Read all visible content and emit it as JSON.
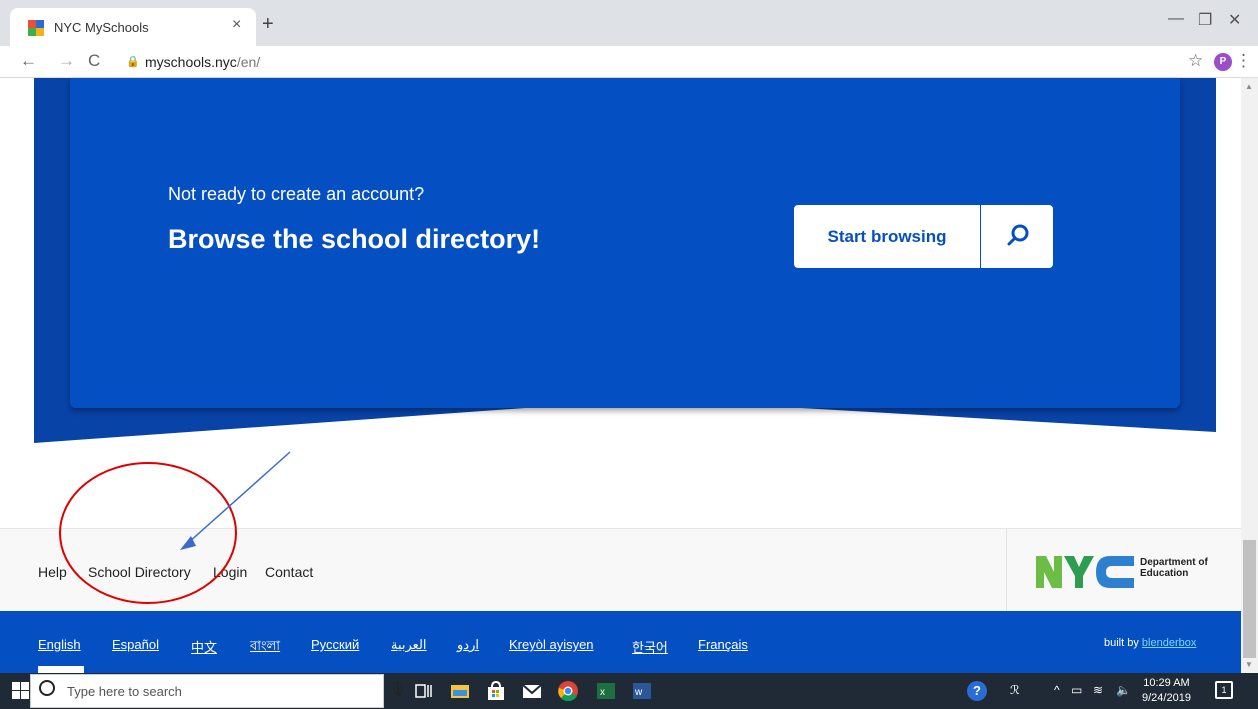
{
  "browser": {
    "tab_title": "NYC MySchools",
    "close_tab": "×",
    "new_tab": "+",
    "url_host": "myschools.nyc",
    "url_path": "/en/",
    "profile_initial": "P"
  },
  "banner": {
    "subtitle": "Not ready to create an account?",
    "title": "Browse the school directory!",
    "start_button": "Start browsing"
  },
  "footer": {
    "links": [
      "Help",
      "School Directory",
      "Login",
      "Contact"
    ],
    "dept_line1": "Department of",
    "dept_line2": "Education"
  },
  "languages": [
    "English",
    "Español",
    "中文",
    "বাংলা",
    "Русский",
    "العربية",
    "اردو",
    "Kreyòl ayisyen",
    "한국어",
    "Français"
  ],
  "built_by": {
    "prefix": "built by ",
    "link": "blenderbox"
  },
  "taskbar": {
    "search_placeholder": "Type here to search",
    "time": "10:29 AM",
    "date": "9/24/2019",
    "notification_count": "1"
  },
  "colors": {
    "brand_blue": "#0450c3",
    "annotation_red": "#e00000",
    "annotation_arrow": "#3a6cc8"
  },
  "icons": [
    "search-icon",
    "back-icon",
    "forward-icon",
    "reload-icon",
    "lock-icon",
    "star-icon",
    "menu-icon",
    "windows-icon"
  ]
}
